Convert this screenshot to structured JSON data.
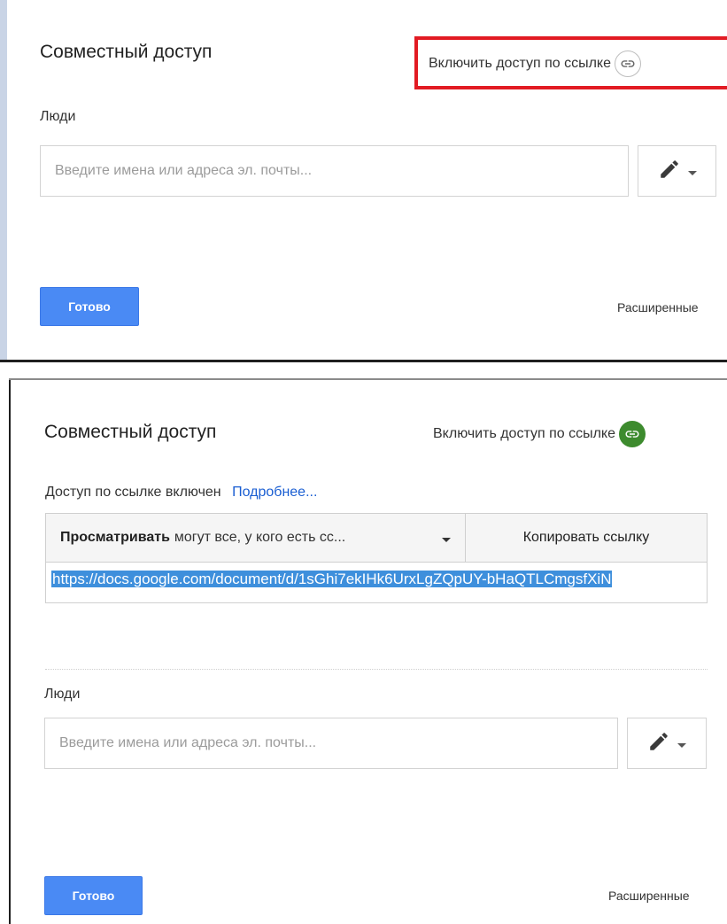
{
  "top_dialog": {
    "title": "Совместный доступ",
    "link_toggle": {
      "label": "Включить доступ по ссылке",
      "icon": "link-icon",
      "state": "off"
    },
    "people_label": "Люди",
    "people_input": {
      "value": "",
      "placeholder": "Введите имена или адреса эл. почты..."
    },
    "permission_icon": "pencil-icon",
    "done_label": "Готово",
    "advanced_label": "Расширенные",
    "highlight_color": "#e21b23"
  },
  "bottom_dialog": {
    "title": "Совместный доступ",
    "link_toggle": {
      "label": "Включить доступ по ссылке",
      "icon": "link-icon",
      "state": "on",
      "color": "#3d8b2e"
    },
    "status": {
      "text": "Доступ по ссылке включен",
      "more_link": "Подробнее..."
    },
    "access": {
      "selected_bold": "Просматривать",
      "selected_rest": "могут все, у кого есть сс...",
      "copy_label": "Копировать ссылку"
    },
    "url": "https://docs.google.com/document/d/1sGhi7ekIHk6UrxLgZQpUY-bHaQTLCmgsfXiN",
    "people_label": "Люди",
    "people_input": {
      "value": "",
      "placeholder": "Введите имена или адреса эл. почты..."
    },
    "permission_icon": "pencil-icon",
    "done_label": "Готово",
    "advanced_label": "Расширенные"
  },
  "colors": {
    "primary_button": "#4a8af4",
    "link_blue": "#1a5ed2",
    "selection_blue": "#3e8fdc"
  }
}
